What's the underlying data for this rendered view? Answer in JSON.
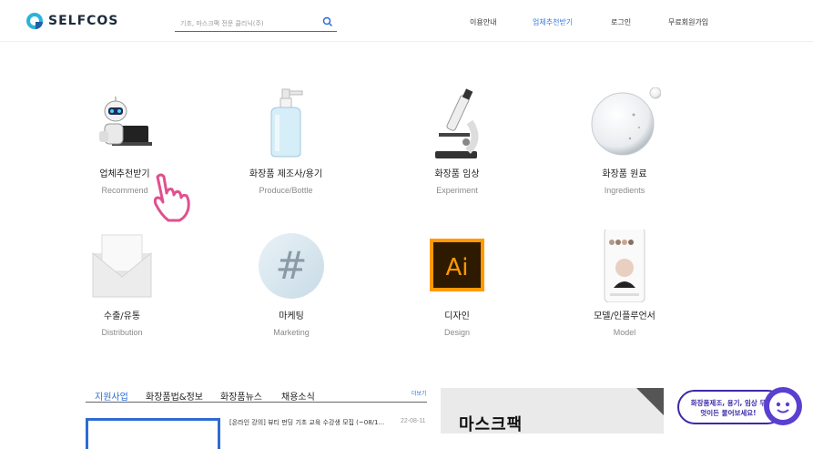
{
  "header": {
    "logo_text": "SELFCOS",
    "search_placeholder": "기초, 마스크팩 전문 클리닉(주)",
    "nav": [
      {
        "label": "이용안내",
        "active": false
      },
      {
        "label": "업체추천받기",
        "active": true
      },
      {
        "label": "로그인",
        "active": false
      },
      {
        "label": "무료회원가입",
        "active": false
      }
    ]
  },
  "categories": [
    {
      "title": "업체추천받기",
      "subtitle": "Recommend",
      "icon": "robot-laptop-icon"
    },
    {
      "title": "화장품 제조사/용기",
      "subtitle": "Produce/Bottle",
      "icon": "pump-bottle-icon"
    },
    {
      "title": "화장품 임상",
      "subtitle": "Experiment",
      "icon": "microscope-icon"
    },
    {
      "title": "화장품 원료",
      "subtitle": "Ingredients",
      "icon": "droplet-bubble-icon"
    },
    {
      "title": "수출/유통",
      "subtitle": "Distribution",
      "icon": "envelope-icon"
    },
    {
      "title": "마케팅",
      "subtitle": "Marketing",
      "icon": "hashtag-icon"
    },
    {
      "title": "디자인",
      "subtitle": "Design",
      "icon": "illustrator-icon"
    },
    {
      "title": "모델/인플루언서",
      "subtitle": "Model",
      "icon": "phone-profile-icon"
    }
  ],
  "tabs": [
    {
      "label": "지원사업",
      "active": true
    },
    {
      "label": "화장품법&정보",
      "active": false
    },
    {
      "label": "화장품뉴스",
      "active": false
    },
    {
      "label": "채용소식",
      "active": false
    }
  ],
  "more_label": "더보기",
  "notice": {
    "text": "[온라인 강의] 뷰티 펀딩 기초 교육 수강생 모집 (~08/1...",
    "date": "22-08-11"
  },
  "banner_text": "마스크팩",
  "chat_text": "화장품제조, 용기, 임상 무엇이든 물어보세요!",
  "colors": {
    "accent": "#3a7be0",
    "brand": "#2bb3d8",
    "chat": "#3b2aa8",
    "hand": "#e0508f"
  }
}
